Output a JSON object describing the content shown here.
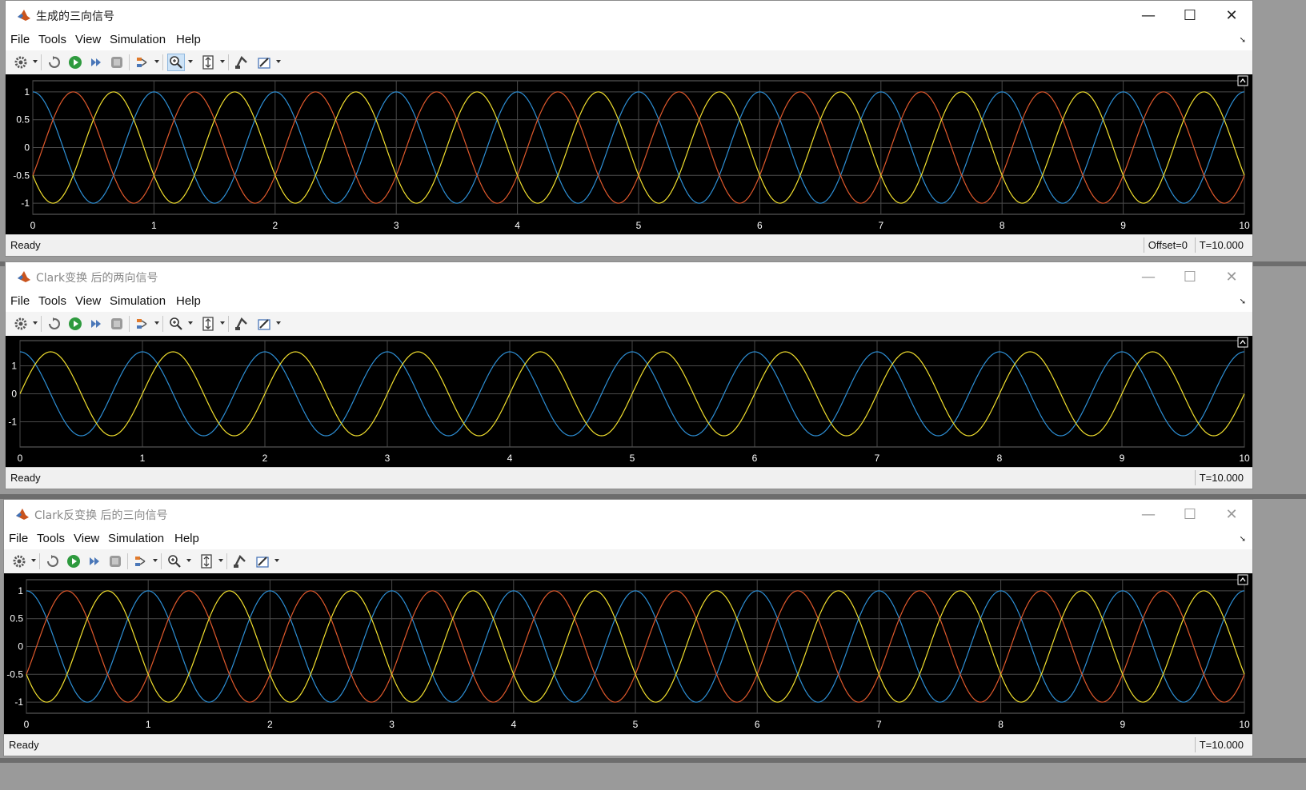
{
  "menu": {
    "file": "File",
    "tools": "Tools",
    "view": "View",
    "simulation": "Simulation",
    "help": "Help"
  },
  "colors": {
    "blue": "#2d8fd5",
    "orange": "#e0592c",
    "yellow": "#f2e02e",
    "grid": "#4a4a4a",
    "axis_label": "#ffffff"
  },
  "icons": [
    "settings-icon",
    "restore-icon",
    "run-icon",
    "step-forward-icon",
    "stop-icon",
    "signal-select-icon",
    "zoom-icon",
    "autoscale-icon",
    "highlight-block-icon",
    "measure-icon",
    "undock-icon",
    "pin-icon"
  ],
  "windows": [
    {
      "title": "生成的三向信号",
      "active": true,
      "status": "Ready",
      "offset": "Offset=0",
      "time": "T=10.000",
      "chart_data": {
        "type": "line",
        "xlim": [
          0,
          10
        ],
        "ylim": [
          -1.2,
          1.2
        ],
        "x_ticks": [
          "0",
          "1",
          "2",
          "3",
          "4",
          "5",
          "6",
          "7",
          "8",
          "9",
          "10"
        ],
        "y_ticks": [
          "1",
          "0.5",
          "0",
          "-0.5",
          "-1"
        ],
        "y_tick_values": [
          1,
          0.5,
          0,
          -0.5,
          -1
        ],
        "grid": true,
        "series": [
          {
            "color": "#2d8fd5",
            "amplitude": 1,
            "frequency_hz": 1,
            "phase_deg": 90
          },
          {
            "color": "#e0592c",
            "amplitude": 1,
            "frequency_hz": 1,
            "phase_deg": -30
          },
          {
            "color": "#f2e02e",
            "amplitude": 1,
            "frequency_hz": 1,
            "phase_deg": 210
          }
        ]
      }
    },
    {
      "title": "Clark变换 后的两向信号",
      "active": false,
      "status": "Ready",
      "offset": "",
      "time": "T=10.000",
      "chart_data": {
        "type": "line",
        "xlim": [
          0,
          10
        ],
        "ylim": [
          -1.9,
          1.9
        ],
        "x_ticks": [
          "0",
          "1",
          "2",
          "3",
          "4",
          "5",
          "6",
          "7",
          "8",
          "9",
          "10"
        ],
        "y_ticks": [
          "1",
          "0",
          "-1"
        ],
        "y_tick_values": [
          1,
          0,
          -1
        ],
        "grid": true,
        "series": [
          {
            "color": "#2d8fd5",
            "amplitude": 1.5,
            "frequency_hz": 1,
            "phase_deg": 90
          },
          {
            "color": "#f2e02e",
            "amplitude": 1.5,
            "frequency_hz": 1,
            "phase_deg": 0
          }
        ]
      }
    },
    {
      "title": "Clark反变换 后的三向信号",
      "active": false,
      "status": "Ready",
      "offset": "",
      "time": "T=10.000",
      "chart_data": {
        "type": "line",
        "xlim": [
          0,
          10
        ],
        "ylim": [
          -1.2,
          1.2
        ],
        "x_ticks": [
          "0",
          "1",
          "2",
          "3",
          "4",
          "5",
          "6",
          "7",
          "8",
          "9",
          "10"
        ],
        "y_ticks": [
          "1",
          "0.5",
          "0",
          "-0.5",
          "-1"
        ],
        "y_tick_values": [
          1,
          0.5,
          0,
          -0.5,
          -1
        ],
        "grid": true,
        "series": [
          {
            "color": "#2d8fd5",
            "amplitude": 1,
            "frequency_hz": 1,
            "phase_deg": 90
          },
          {
            "color": "#e0592c",
            "amplitude": 1,
            "frequency_hz": 1,
            "phase_deg": -30
          },
          {
            "color": "#f2e02e",
            "amplitude": 1,
            "frequency_hz": 1,
            "phase_deg": 210
          }
        ]
      }
    }
  ]
}
